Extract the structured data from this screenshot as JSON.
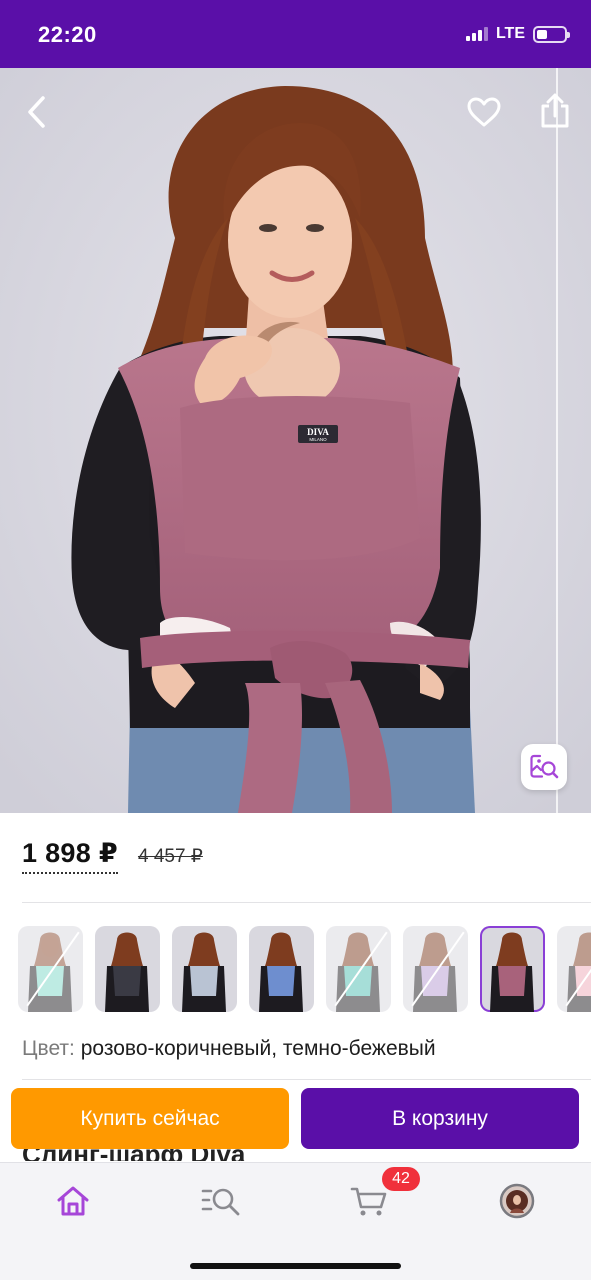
{
  "status_bar": {
    "time": "22:20",
    "network": "LTE",
    "battery_level": 0.35
  },
  "header": {
    "back_icon": "chevron-left-icon",
    "favorite_icon": "heart-outline-icon",
    "share_icon": "share-icon",
    "visual_search_icon": "image-search-icon"
  },
  "product_image": {
    "logo_text": "DIVA",
    "logo_subtext": "MILANO"
  },
  "price": {
    "current": "1 898 ₽",
    "old": "4 457 ₽"
  },
  "color_variants": [
    {
      "name": "mint",
      "available": false,
      "selected": false
    },
    {
      "name": "black",
      "available": true,
      "selected": false
    },
    {
      "name": "grey",
      "available": true,
      "selected": false
    },
    {
      "name": "blue",
      "available": true,
      "selected": false
    },
    {
      "name": "turquoise",
      "available": false,
      "selected": false
    },
    {
      "name": "lilac",
      "available": false,
      "selected": false
    },
    {
      "name": "rose-brown",
      "available": true,
      "selected": true
    },
    {
      "name": "pink",
      "available": false,
      "selected": false
    }
  ],
  "colors": {
    "brand_purple": "#5a0fa8",
    "buy_orange": "#ff9900",
    "badge_red": "#f0303b",
    "sling_color": "#b06c83",
    "accent_purple": "#a646d8"
  },
  "color_info": {
    "label": "Цвет:",
    "value": "розово-коричневый, темно-бежевый"
  },
  "actions": {
    "buy_now": "Купить сейчас",
    "add_to_cart": "В корзину"
  },
  "product_title": "Слинг-шарф Diva",
  "tab_bar": {
    "items": [
      {
        "icon": "home-icon",
        "active": true
      },
      {
        "icon": "catalog-search-icon",
        "active": false
      },
      {
        "icon": "cart-icon",
        "active": false,
        "badge": "42"
      },
      {
        "icon": "profile-avatar",
        "active": false
      }
    ]
  }
}
